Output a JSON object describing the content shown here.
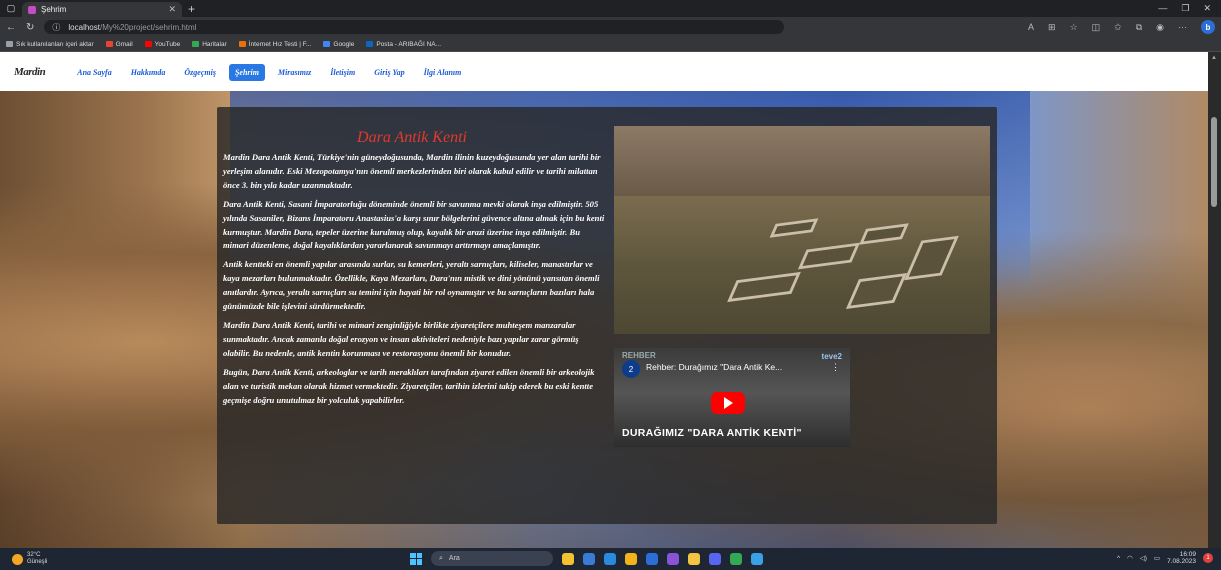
{
  "browser": {
    "tab_title": "Şehrim",
    "url_host": "localhost",
    "url_path": "/My%20project/sehrim.html",
    "bookmarks": [
      {
        "label": "Sık kullanılanları içeri aktar",
        "color": "#9aa0a6"
      },
      {
        "label": "Gmail",
        "color": "#ea4335"
      },
      {
        "label": "YouTube",
        "color": "#ff0000"
      },
      {
        "label": "Haritalar",
        "color": "#34a853"
      },
      {
        "label": "İnternet Hız Testi | F...",
        "color": "#e8710a"
      },
      {
        "label": "Google",
        "color": "#4285f4"
      },
      {
        "label": "Posta - ARIBAĞI NA...",
        "color": "#0a66c2"
      }
    ]
  },
  "nav": {
    "logo": "Mardin",
    "items": [
      {
        "label": "Ana Sayfa"
      },
      {
        "label": "Hakkımda"
      },
      {
        "label": "Özgeçmiş"
      },
      {
        "label": "Şehrim",
        "active": true
      },
      {
        "label": "Mirasımız"
      },
      {
        "label": "İletişim"
      },
      {
        "label": "Giriş Yap"
      },
      {
        "label": "İlgi Alanım"
      }
    ]
  },
  "content": {
    "title": "Dara Antik Kenti",
    "paragraphs": [
      "Mardin Dara Antik Kenti, Türkiye'nin güneydoğusunda, Mardin ilinin kuzeydoğusunda yer alan tarihi bir yerleşim alanıdır. Eski Mezopotamya'nın önemli merkezlerinden biri olarak kabul edilir ve tarihi milattan önce 3. bin yıla kadar uzanmaktadır.",
      "Dara Antik Kenti, Sasani İmparatorluğu döneminde önemli bir savunma mevki olarak inşa edilmiştir. 505 yılında Sasaniler, Bizans İmparatoru Anastasius'a karşı sınır bölgelerini güvence altına almak için bu kenti kurmuştur. Mardin Dara, tepeler üzerine kurulmuş olup, kayalık bir arazi üzerine inşa edilmiştir. Bu mimari düzenleme, doğal kayalıklardan yararlanarak savunmayı arttırmayı amaçlamıştır.",
      "Antik kentteki en önemli yapılar arasında surlar, su kemerleri, yeraltı sarnıçları, kiliseler, manastırlar ve kaya mezarları bulunmaktadır. Özellikle, Kaya Mezarları, Dara'nın mistik ve dini yönünü yansıtan önemli anıtlardır. Ayrıca, yeraltı sarnıçları su temini için hayati bir rol oynamıştır ve bu sarnıçların bazıları hala günümüzde bile işlevini sürdürmektedir.",
      "Mardin Dara Antik Kenti, tarihi ve mimari zenginliğiyle birlikte ziyaretçilere muhteşem manzaralar sunmaktadır. Ancak zamanla doğal erozyon ve insan aktiviteleri nedeniyle bazı yapılar zarar görmüş olabilir. Bu nedenle, antik kentin korunması ve restorasyonu önemli bir konudur.",
      "Bugün, Dara Antik Kenti, arkeologlar ve tarih meraklıları tarafından ziyaret edilen önemli bir arkeolojik alan ve turistik mekan olarak hizmet vermektedir. Ziyaretçiler, tarihin izlerini takip ederek bu eski kentte geçmişe doğru unutulmaz bir yolculuk yapabilirler."
    ],
    "video": {
      "title": "Rehber: Durağımız \"Dara Antik Ke...",
      "channel_badge": "2",
      "channel_overlay": "REHBER",
      "brand": "teve2",
      "caption": "DURAĞIMIZ \"DARA ANTİK KENTİ\""
    }
  },
  "taskbar": {
    "weather_temp": "32°C",
    "weather_desc": "Güneşli",
    "search_placeholder": "Ara",
    "time": "16:09",
    "date": "7.08.2023",
    "icons": [
      "file-explorer",
      "media",
      "vscode",
      "chrome-canary",
      "store",
      "visual-studio",
      "folder",
      "discord",
      "chrome",
      "app"
    ],
    "icon_colors": [
      "#f2c230",
      "#3a7bd5",
      "#2a8ae0",
      "#f2b31a",
      "#2b6fd6",
      "#8a52d6",
      "#f4c542",
      "#5865f2",
      "#34a853",
      "#3aa0e8"
    ]
  }
}
